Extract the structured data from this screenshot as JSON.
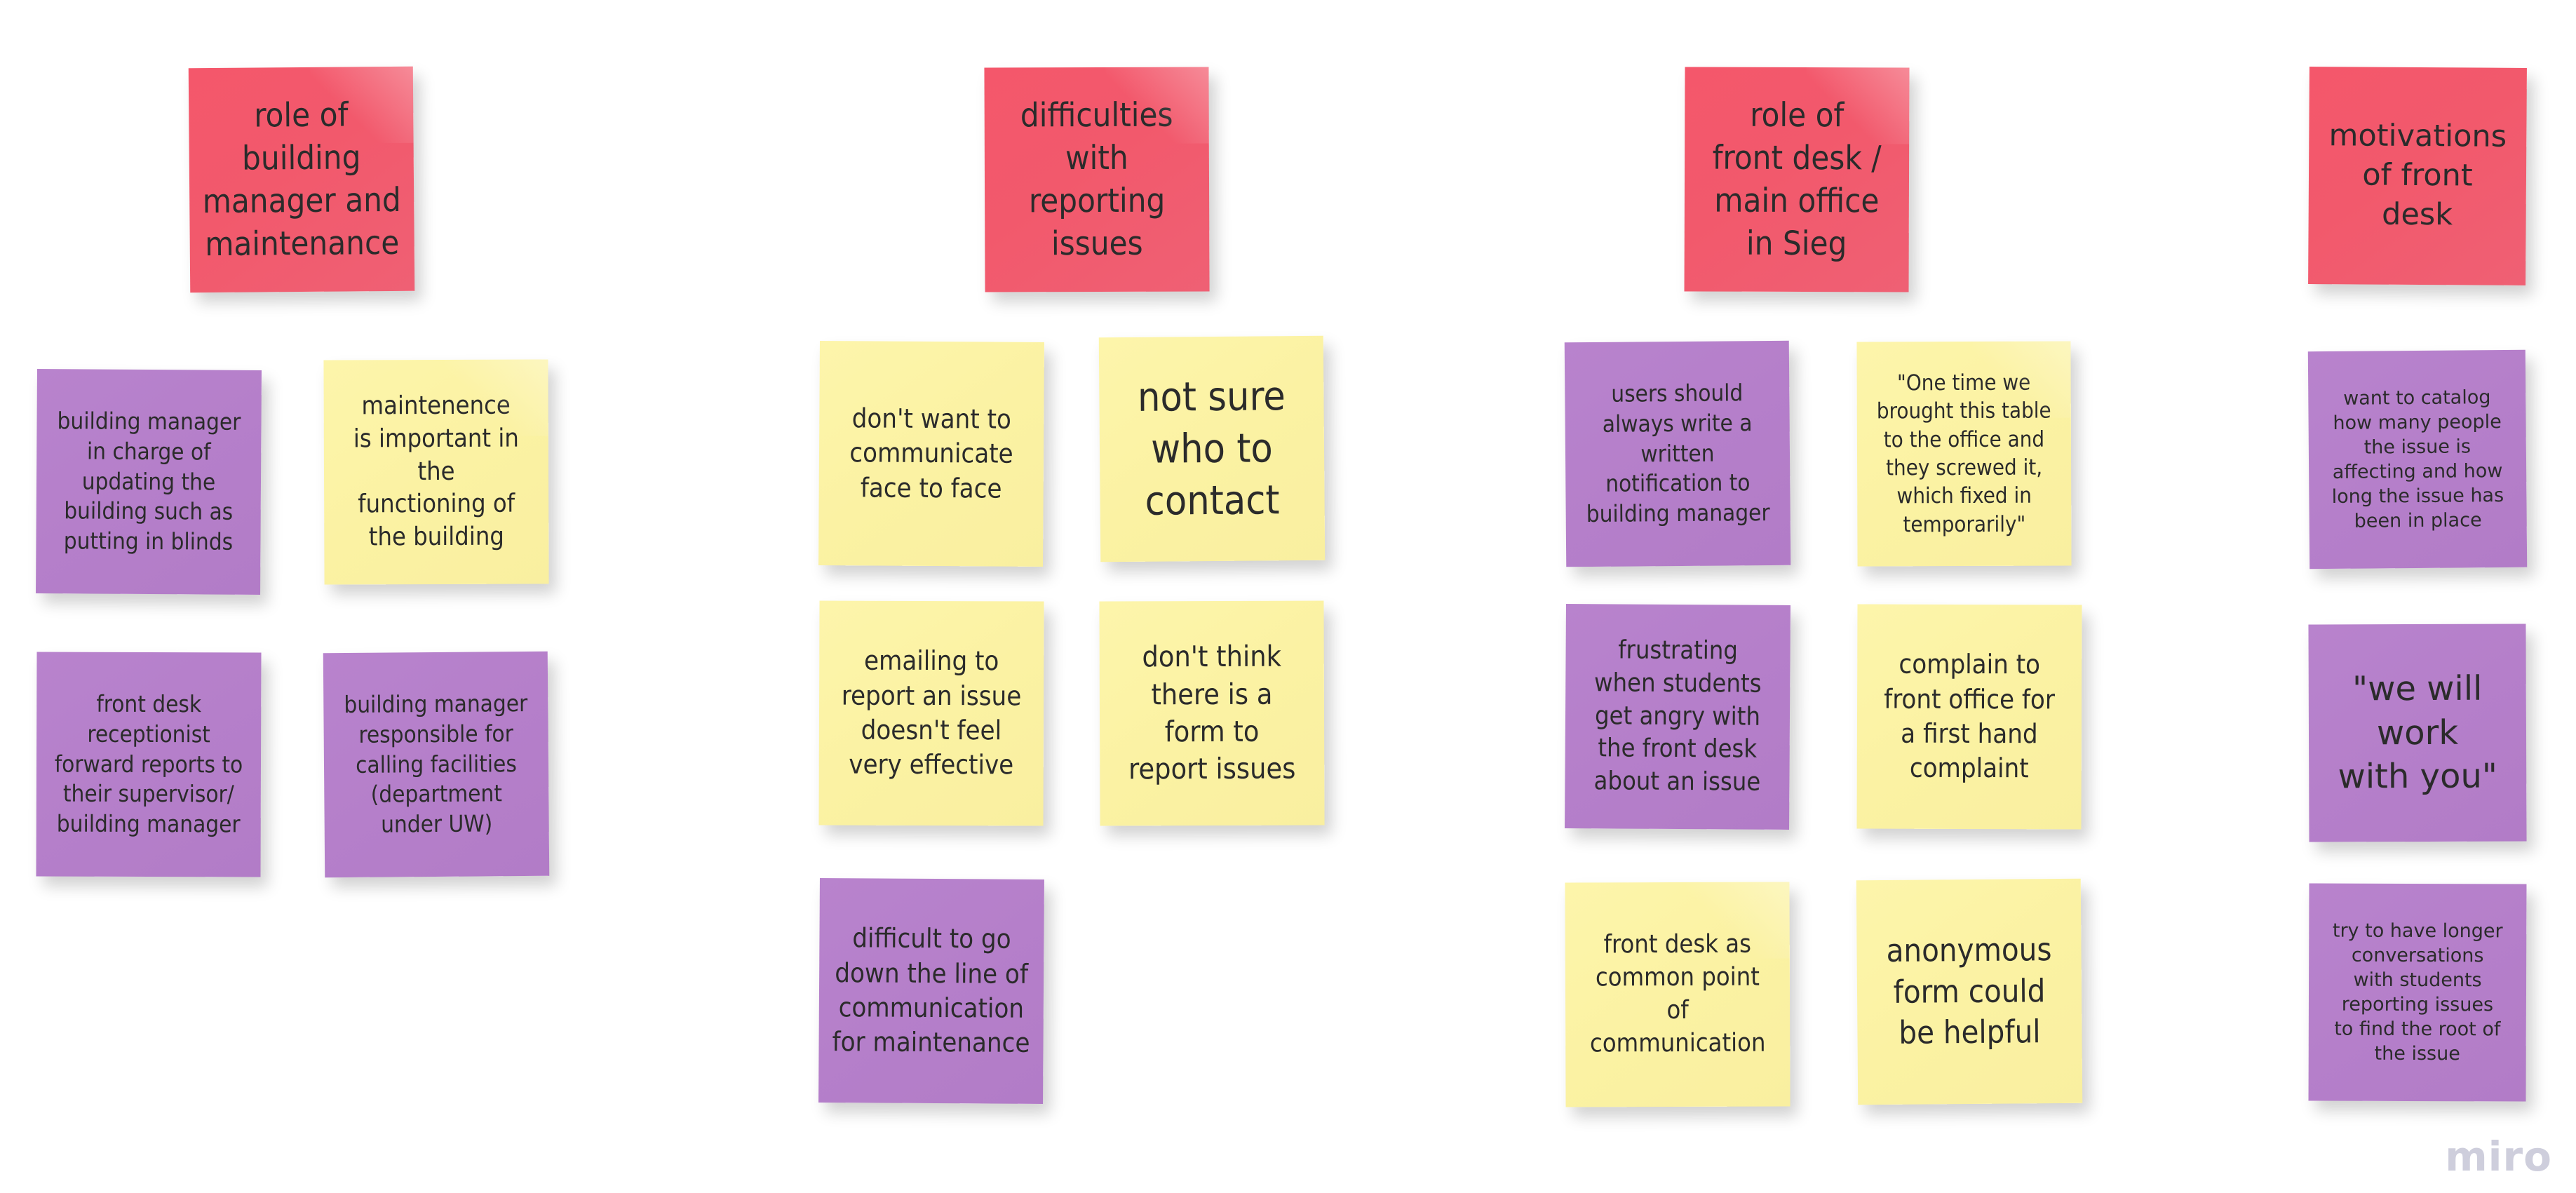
{
  "board": {
    "app_name": "miro",
    "watermark": "miro",
    "colors": {
      "pink": "#f2596c",
      "yellow": "#fbf2a3",
      "purple": "#b57fca",
      "text": "#2b2b2b",
      "canvas": "#ffffff",
      "watermark": "#c6c6d6"
    }
  },
  "columns": [
    {
      "id": "column-1",
      "header": {
        "text": "role of\nbuilding\nmanager and\nmaintenance",
        "color": "pink"
      },
      "notes": [
        {
          "text": "building manager\nin charge of\nupdating the\nbuilding such as\nputting in blinds",
          "color": "purple"
        },
        {
          "text": "maintenence\nis important in\nthe\nfunctioning of\nthe building",
          "color": "yellow"
        },
        {
          "text": "front desk\nreceptionist\nforward reports to\ntheir supervisor/\nbuilding manager",
          "color": "purple"
        },
        {
          "text": "building manager\nresponsible for\ncalling facilities\n(department\nunder UW)",
          "color": "purple"
        }
      ]
    },
    {
      "id": "column-2",
      "header": {
        "text": "difficulties\nwith\nreporting\nissues",
        "color": "pink"
      },
      "notes": [
        {
          "text": "don't want to\ncommunicate\nface to face",
          "color": "yellow"
        },
        {
          "text": "not sure\nwho to\ncontact",
          "color": "yellow"
        },
        {
          "text": "emailing to\nreport an issue\ndoesn't feel\nvery effective",
          "color": "yellow"
        },
        {
          "text": "don't think\nthere is a\nform to\nreport issues",
          "color": "yellow"
        },
        {
          "text": "difficult to go\ndown the line of\ncommunication\nfor maintenance",
          "color": "purple"
        }
      ]
    },
    {
      "id": "column-3",
      "header": {
        "text": "role of\nfront desk /\nmain office\nin Sieg",
        "color": "pink"
      },
      "notes": [
        {
          "text": "users should\nalways write a\nwritten\nnotification to\nbuilding manager",
          "color": "purple"
        },
        {
          "text": "\"One time we\nbrought this table\nto the office and\nthey screwed it,\nwhich fixed in\ntemporarily\"",
          "color": "yellow"
        },
        {
          "text": "frustrating\nwhen students\nget angry with\nthe front desk\nabout an issue",
          "color": "purple"
        },
        {
          "text": "complain to\nfront office for\na first hand\ncomplaint",
          "color": "yellow"
        },
        {
          "text": "front desk as\ncommon point\nof\ncommunication",
          "color": "yellow"
        },
        {
          "text": "anonymous\nform could\nbe helpful",
          "color": "yellow"
        }
      ]
    },
    {
      "id": "column-4",
      "header": {
        "text": "motivations\nof front\ndesk",
        "color": "pink"
      },
      "notes": [
        {
          "text": "want to catalog\nhow many people\nthe issue is\naffecting and how\nlong the issue has\nbeen in place",
          "color": "purple"
        },
        {
          "text": "\"we will\nwork\nwith you\"",
          "color": "purple"
        },
        {
          "text": "try to have longer\nconversations\nwith students\nreporting issues\nto find the root of\nthe issue",
          "color": "purple"
        }
      ]
    }
  ]
}
